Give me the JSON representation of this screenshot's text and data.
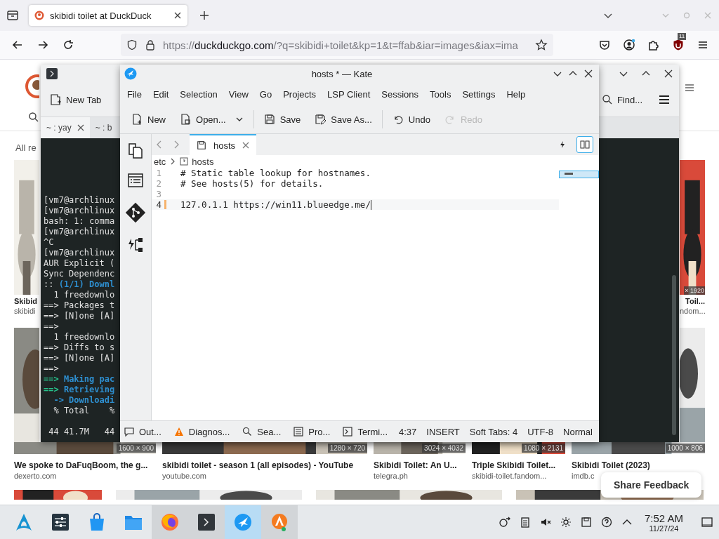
{
  "browser": {
    "tabs": [
      {
        "title": "skibidi toilet at DuckDuck",
        "selected": true
      }
    ],
    "address": {
      "scheme": "https://",
      "host": "duckduckgo.com",
      "path": "/?q=skibidi+toilet&kp=1&t=ffab&iar=images&iax=ima"
    },
    "extension_badge": "11"
  },
  "page": {
    "filter_label": "All re",
    "row_1": [
      {
        "title": "Skibid",
        "source": "skibidi"
      },
      {
        "size": "× 1920",
        "title": "Toil...",
        "source": "ndom..."
      }
    ],
    "row_2": [
      {
        "size": "1600 × 900",
        "title": "We spoke to DaFuqBoom, the g...",
        "source": "dexerto.com"
      },
      {
        "size": "1280 × 720",
        "title": "skibidi toilet - season 1 (all episodes) - YouTube",
        "source": "youtube.com"
      },
      {
        "size": "3024 × 4032",
        "title": "Skibidi Toilet: An U...",
        "source": "telegra.ph"
      },
      {
        "size": "1080 × 2131",
        "title": "Triple Skibidi Toilet...",
        "source": "skibidi-toilet.fandom..."
      },
      {
        "size": "1000 × 806",
        "title": "Skibidi Toilet (2023)",
        "source": "imdb.c"
      }
    ],
    "share_feedback": "Share Feedback"
  },
  "terminal": {
    "new_tab": "New Tab",
    "find": "Find...",
    "tabs": [
      {
        "label": "~ : yay",
        "selected": true
      },
      {
        "label": "~ : b",
        "selected": false
      }
    ],
    "lines": [
      {
        "kind": "plain",
        "text": "[vm7@archlinux"
      },
      {
        "kind": "plain",
        "text": "[vm7@archlinux"
      },
      {
        "kind": "plain",
        "text": "bash: 1: comma"
      },
      {
        "kind": "plain",
        "text": "[vm7@archlinux"
      },
      {
        "kind": "plain",
        "text": "^C"
      },
      {
        "kind": "plain",
        "text": "[vm7@archlinux"
      },
      {
        "kind": "plain",
        "text": "AUR Explicit ("
      },
      {
        "kind": "plain",
        "text": "Sync Dependenc"
      },
      {
        "kind": "info",
        "prefix": ":: ",
        "text": "(1/1) Downl"
      },
      {
        "kind": "plain",
        "text": "  1 freedownlo"
      },
      {
        "kind": "plain",
        "text": "==> Packages t"
      },
      {
        "kind": "plain",
        "text": "==> [N]one [A]"
      },
      {
        "kind": "plain",
        "text": "==>"
      },
      {
        "kind": "plain",
        "text": "  1 freedownlo"
      },
      {
        "kind": "plain",
        "text": "==> Diffs to s"
      },
      {
        "kind": "plain",
        "text": "==> [N]one [A]"
      },
      {
        "kind": "plain",
        "text": "==>"
      },
      {
        "kind": "heading",
        "prefix": "==> ",
        "text": "Making pac"
      },
      {
        "kind": "heading",
        "prefix": "==> ",
        "text": "Retrieving"
      },
      {
        "kind": "info",
        "text": "  -> Downloadi"
      },
      {
        "kind": "plain",
        "text": "  % Total    %"
      },
      {
        "kind": "blank"
      },
      {
        "kind": "plain",
        "text": " 44 41.7M   44"
      }
    ]
  },
  "kate": {
    "title": "hosts * — Kate",
    "menu": [
      "File",
      "Edit",
      "Selection",
      "View",
      "Go",
      "Projects",
      "LSP Client",
      "Sessions",
      "Tools",
      "Settings",
      "Help"
    ],
    "toolbar": [
      [
        {
          "kind": "new",
          "label": "New",
          "disabled": false
        },
        {
          "kind": "open",
          "label": "Open...",
          "disabled": false,
          "dropdown": true
        }
      ],
      [
        {
          "kind": "save",
          "label": "Save",
          "disabled": false
        },
        {
          "kind": "save_as",
          "label": "Save As...",
          "disabled": false
        }
      ],
      [
        {
          "kind": "undo",
          "label": "Undo",
          "disabled": false
        },
        {
          "kind": "redo",
          "label": "Redo",
          "disabled": true
        }
      ]
    ],
    "tabs": [
      {
        "label": "hosts",
        "selected": true
      }
    ],
    "breadcrumb": [
      "etc",
      "hosts"
    ],
    "lines": [
      {
        "number": "1",
        "text": "# Static table lookup for hostnames.",
        "modified": false,
        "current": false
      },
      {
        "number": "2",
        "text": "# See hosts(5) for details.",
        "modified": false,
        "current": false
      },
      {
        "number": "3",
        "modified": false,
        "current": false
      },
      {
        "number": "4",
        "text": "127.0.1.1 https://win11.blueedge.me/",
        "modified": true,
        "current": true
      }
    ],
    "status": [
      {
        "kind": "output",
        "label": "Out..."
      },
      {
        "kind": "diagnostics",
        "label": "Diagnos..."
      },
      {
        "kind": "search",
        "label": "Sea..."
      },
      {
        "kind": "projects",
        "label": "Pro..."
      },
      {
        "kind": "terminal",
        "label": "Termi..."
      },
      {
        "kind": "info",
        "label": "4:37"
      },
      {
        "kind": "info",
        "label": "INSERT"
      },
      {
        "kind": "info",
        "label": "Soft Tabs: 4"
      },
      {
        "kind": "info",
        "label": "UTF-8"
      },
      {
        "kind": "info",
        "label": "Normal"
      }
    ]
  },
  "taskbar": {
    "apps": [
      {
        "kind": "launcher",
        "open": false,
        "selected": false
      },
      {
        "kind": "sliders",
        "open": false,
        "selected": false
      },
      {
        "kind": "store",
        "open": false,
        "selected": false
      },
      {
        "kind": "folder",
        "open": false,
        "selected": false
      },
      {
        "kind": "firefox",
        "open": true,
        "selected": false
      },
      {
        "kind": "terminal",
        "open": true,
        "selected": false
      },
      {
        "kind": "kate",
        "open": true,
        "selected": true
      },
      {
        "kind": "installer",
        "open": true,
        "selected": false
      }
    ],
    "time": "7:52 AM",
    "date": "11/27/24"
  }
}
